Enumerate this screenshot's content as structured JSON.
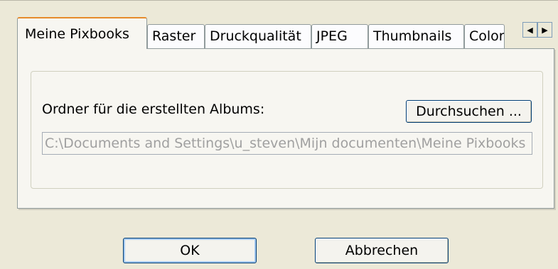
{
  "tabs": [
    {
      "label": "Meine Pixbooks",
      "active": true
    },
    {
      "label": "Raster"
    },
    {
      "label": "Druckqualität"
    },
    {
      "label": "JPEG"
    },
    {
      "label": "Thumbnails"
    },
    {
      "label": "Color"
    }
  ],
  "tab_scroll": {
    "left_icon": "arrow-left-icon",
    "left_glyph": "◀",
    "right_icon": "arrow-right-icon",
    "right_glyph": "▶"
  },
  "content": {
    "folder_label": "Ordner für die erstellten Albums:",
    "browse_label": "Durchsuchen ...",
    "path_value": "C:\\Documents and Settings\\u_steven\\Mijn documenten\\Meine Pixbooks"
  },
  "footer": {
    "ok_label": "OK",
    "cancel_label": "Abbrechen"
  },
  "colors": {
    "dialog_bg": "#ece9d8",
    "active_tab_accent": "#e68b2c",
    "button_border": "#003c74",
    "disabled_text": "#a0a0a0"
  }
}
